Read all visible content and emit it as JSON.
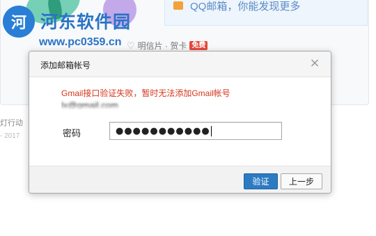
{
  "background": {
    "tip_text": "QQ邮箱，你能发现更多",
    "postcard_text": "明信片 · 贺卡",
    "free_badge": "免费",
    "side_text_1": "灯行动",
    "side_text_2": "- 2017"
  },
  "watermark": {
    "logo_text": "河",
    "title": "河东软件园",
    "url": "www.pc0359.cn"
  },
  "dialog": {
    "title": "添加邮箱帐号",
    "close_symbol": "×",
    "error_message": "Gmail接口验证失败，暂时无法添加Gmail帐号",
    "account_value": "lx@gmail.com",
    "password_label": "密码",
    "password_value": "●●●●●●●●●●●",
    "verify_button": "验证",
    "back_button": "上一步"
  },
  "colors": {
    "primary_button": "#2c7bc2",
    "error_text": "#d4361b",
    "watermark_blue": "#2a73c6"
  }
}
